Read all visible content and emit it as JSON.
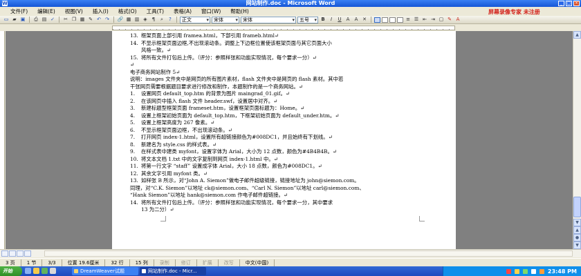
{
  "window": {
    "title": "网站制作.doc - Microsoft Word"
  },
  "menu": [
    "文件(F)",
    "编辑(E)",
    "视图(V)",
    "插入(I)",
    "格式(O)",
    "工具(T)",
    "表格(A)",
    "窗口(W)",
    "帮助(H)"
  ],
  "watermark": "屏幕录像专家  未注册",
  "toolbar": {
    "style": "正文",
    "font_latin": "宋体",
    "font_east": "宋体",
    "size": "五号",
    "bold": "B",
    "italic": "I",
    "underline": "U"
  },
  "document": {
    "lines": [
      {
        "num": "13.",
        "text": "框架页面上部引用 framea.html，下部引用 frameb.html↵"
      },
      {
        "num": "14.",
        "text": "不显示框架页面边框,不出现滚动条。调整上下边框位置使该框架页面与其它页面大小"
      },
      {
        "num": "",
        "text": "风格一致。↵",
        "indent": true
      },
      {
        "num": "15.",
        "text": "将所有文件打包后上传。（评分：参照样张和功能实现情况，每个要求一分）↵"
      },
      {
        "num": "",
        "text": "↵"
      },
      {
        "num": "",
        "text": "电子商务网站制作 5↵"
      },
      {
        "num": "",
        "text": "说明：images 文件夹中是网页的所有图片素材，flash 文件夹中是网页的 flash 素材。其中若"
      },
      {
        "num": "",
        "text": "干张网页需要根据题目要求进行修改和制作，本题制作的是一个商务网站。↵"
      },
      {
        "num": "1.",
        "text": "设置网页 default_top.htm 的背景为图片 maingrad_01.gif。↵"
      },
      {
        "num": "2.",
        "text": "在该网页中插入 flash 文件 header.swf，设置居中对齐。↵"
      },
      {
        "num": "3.",
        "text": "新建标题型框架页面 frameset.htm，设置框架页面标题为：Home。↵"
      },
      {
        "num": "4.",
        "text": "设置上框架初始页面为 default_top.htm，下框架初始页面为 default_under.htm。↵"
      },
      {
        "num": "5.",
        "text": "设置上框架高度为 267 像素。↵"
      },
      {
        "num": "6.",
        "text": "不显示框架页面边框，不出现滚动条。↵"
      },
      {
        "num": "7.",
        "text": "打开网页 index-1.html，设置所有超链接颜色为#008DC1，并且始终有下划线。↵"
      },
      {
        "num": "8.",
        "text": "新建名为 style.css 的样式表。↵"
      },
      {
        "num": "9.",
        "text": "在样式表中建类 myfont，设置字体为 Arial，大小为 12 点数，颜色为#4B4B4B。↵"
      },
      {
        "num": "10.",
        "text": "将文本文档 1.txt 中的文字复制到网页 index-1.html 中。↵"
      },
      {
        "num": "11.",
        "text": "将第一行文字 “staff” 设置成字体 Arial，大小 18 点数，颜色为#008DC1。↵"
      },
      {
        "num": "12.",
        "text": "其余文字引用 myfont 类。↵"
      },
      {
        "num": "13.",
        "text": "如样张 B 所示，对“John A. Siemon”做电子邮件超级链接，链接地址为 john@siemon.com。"
      },
      {
        "num": "",
        "text": "同理，对“C.K. Siemon”以地址 ck@siemon.com、“Carl N. Siemon”以地址 carl@siemon.com、"
      },
      {
        "num": "",
        "text": "“Hank Siemon”以地址 hank@siemon.com 作电子邮件超链接。↵"
      },
      {
        "num": "14.",
        "text": "将所有文件打包后上传。（评分：参照样张和功能实现情况，每个要求一分，其中要求"
      },
      {
        "num": "",
        "text": "13 为二分）↵",
        "indent": true
      }
    ]
  },
  "status": {
    "page": "3 页",
    "section": "1 节",
    "pages": "3/3",
    "position": "位置 19.6厘米",
    "line": "32 行",
    "col": "15 列",
    "rec": "录制",
    "trk": "修订",
    "ext": "扩展",
    "ovr": "改写",
    "lang": "中文(中国)"
  },
  "taskbar": {
    "start": "开始",
    "tasks": [
      "DreamWeaver试题",
      "网站制作.doc - Micr..."
    ],
    "clock": "23:48 PM"
  }
}
